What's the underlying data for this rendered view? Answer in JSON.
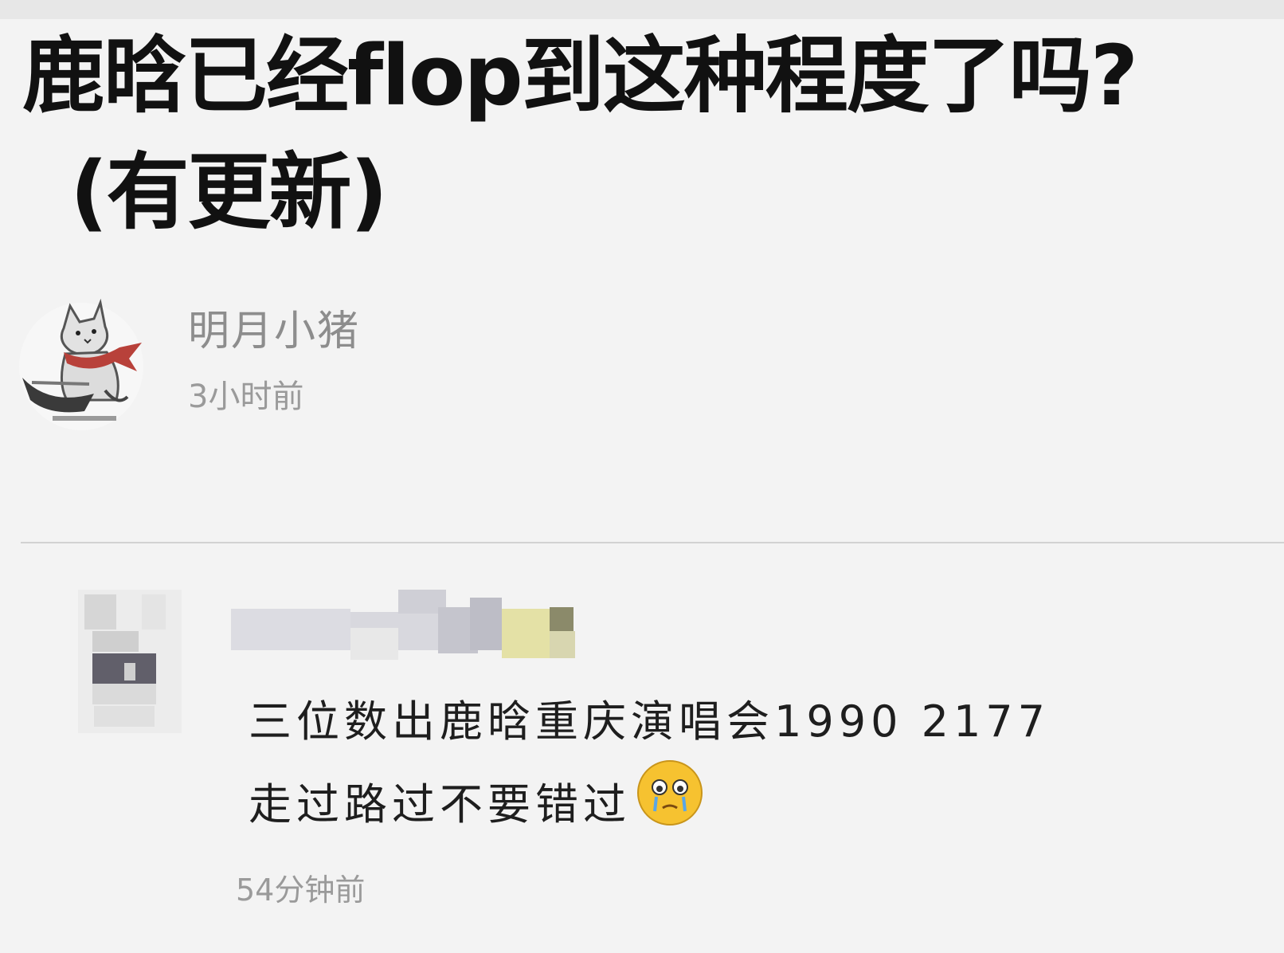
{
  "post": {
    "title_line1": "鹿晗已经flop到这种程度了吗?",
    "title_line2": "(有更新)"
  },
  "author": {
    "name": "明月小猪",
    "time": "3小时前"
  },
  "reply": {
    "username_blurred": "",
    "text_line1": "三位数出鹿晗重庆演唱会1990 2177",
    "text_line2": "走过路过不要错过",
    "emoji": "crying-face-icon",
    "time": "54分钟前"
  },
  "colors": {
    "background": "#f3f3f3",
    "title": "#111111",
    "meta": "#9a9a9a",
    "divider": "#d2d2d2"
  }
}
